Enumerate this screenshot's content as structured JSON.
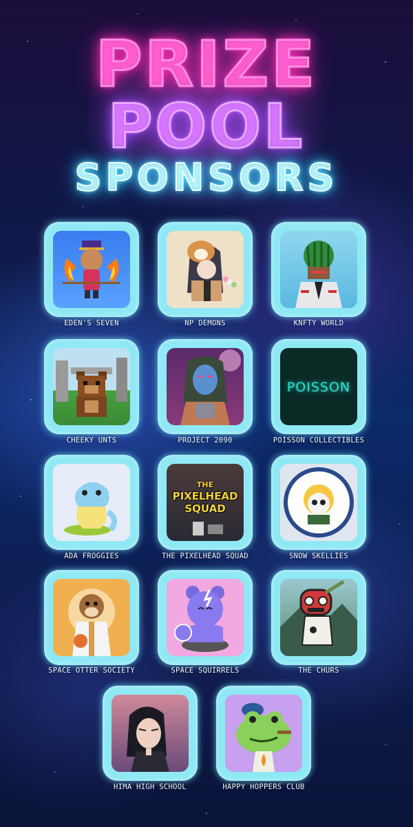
{
  "header": {
    "line1": "PRIZE",
    "line2": "POOL",
    "line3": "SPONSORS"
  },
  "sponsors": [
    {
      "name": "EDEN'S SEVEN",
      "icon": "pixel-monk-avatar"
    },
    {
      "name": "NP DEMONS",
      "icon": "girl-with-shiba-mask-avatar"
    },
    {
      "name": "KNFTY WORLD",
      "icon": "watermelon-head-avatar"
    },
    {
      "name": "CHEEKY UNTS",
      "icon": "pixel-bear-avatar"
    },
    {
      "name": "PROJECT 2090",
      "icon": "cyber-woman-avatar"
    },
    {
      "name": "POISSON COLLECTIBLES",
      "icon": "poisson-logo"
    },
    {
      "name": "ADA FROGGIES",
      "icon": "yellow-frog-dino-avatar"
    },
    {
      "name": "THE PIXELHEAD SQUAD",
      "icon": "pixelhead-squad-logo"
    },
    {
      "name": "SNOW SKELLIES",
      "icon": "snow-skellies-badge"
    },
    {
      "name": "SPACE OTTER SOCIETY",
      "icon": "otter-captain-avatar"
    },
    {
      "name": "SPACE SQUIRRELS",
      "icon": "purple-squirrel-avatar"
    },
    {
      "name": "THE CHURS",
      "icon": "red-masked-creature-avatar"
    },
    {
      "name": "HIMA HIGH SCHOOL",
      "icon": "anime-girl-avatar"
    },
    {
      "name": "HAPPY HOPPERS CLUB",
      "icon": "green-frog-cigar-avatar"
    }
  ],
  "logos": {
    "poisson": "POISSON",
    "pixelhead_line1": "THE",
    "pixelhead_line2": "PIXELHEAD",
    "pixelhead_line3": "SQUAD",
    "snow_skellies": "SNOW SKELLIES"
  },
  "colors": {
    "card_frame": "#8fe9f5",
    "neon_pink": "#ff3fc8",
    "neon_purple": "#b060ff",
    "neon_cyan": "#40d8ff"
  }
}
